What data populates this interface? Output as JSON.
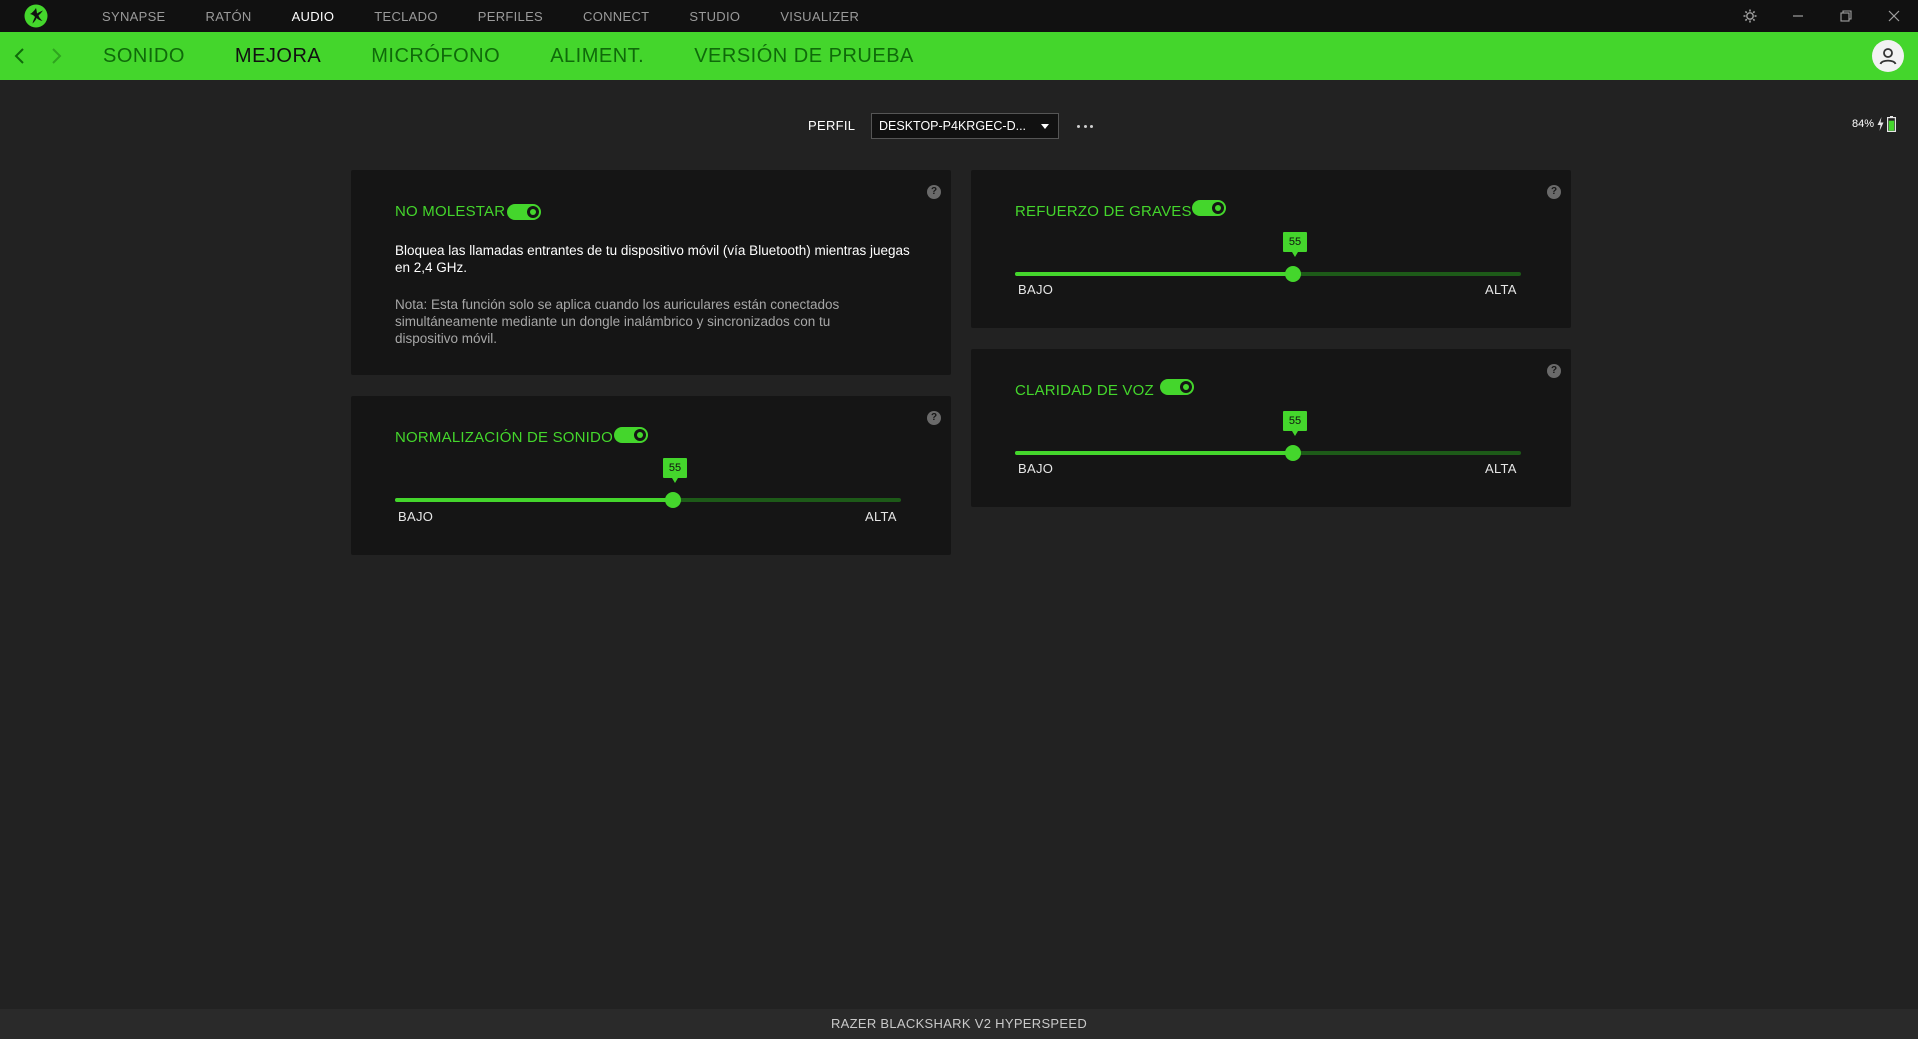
{
  "topnav": {
    "items": [
      "SYNAPSE",
      "RATÓN",
      "AUDIO",
      "TECLADO",
      "PERFILES",
      "CONNECT",
      "STUDIO",
      "VISUALIZER"
    ],
    "active_index": 2
  },
  "subnav": {
    "tabs": [
      "SONIDO",
      "MEJORA",
      "MICRÓFONO",
      "ALIMENT.",
      "VERSIÓN DE PRUEBA"
    ],
    "active_index": 1
  },
  "profile": {
    "label": "PERFIL",
    "value": "DESKTOP-P4KRGEC-D..."
  },
  "battery": {
    "percent_text": "84%",
    "level": 0.84
  },
  "cards": {
    "no_molestar": {
      "title": "NO MOLESTAR",
      "enabled": true,
      "description": "Bloquea las llamadas entrantes de tu dispositivo móvil (vía Bluetooth) mientras juegas en 2,4 GHz.",
      "note": "Nota: Esta función solo se aplica cuando los auriculares están conectados simultáneamente mediante un dongle inalámbrico y sincronizados con tu dispositivo móvil."
    },
    "normalizacion": {
      "title": "NORMALIZACIÓN DE SONIDO",
      "enabled": true,
      "value": 55,
      "value_text": "55",
      "low": "BAJO",
      "high": "ALTA"
    },
    "graves": {
      "title": "REFUERZO DE GRAVES",
      "enabled": true,
      "value": 55,
      "value_text": "55",
      "low": "BAJO",
      "high": "ALTA"
    },
    "claridad": {
      "title": "CLARIDAD DE VOZ",
      "enabled": true,
      "value": 55,
      "value_text": "55",
      "low": "BAJO",
      "high": "ALTA"
    }
  },
  "help_symbol": "?",
  "footer": {
    "device": "RAZER BLACKSHARK V2 HYPERSPEED"
  },
  "colors": {
    "accent": "#44d62c",
    "background": "#222222",
    "card": "#151515"
  }
}
